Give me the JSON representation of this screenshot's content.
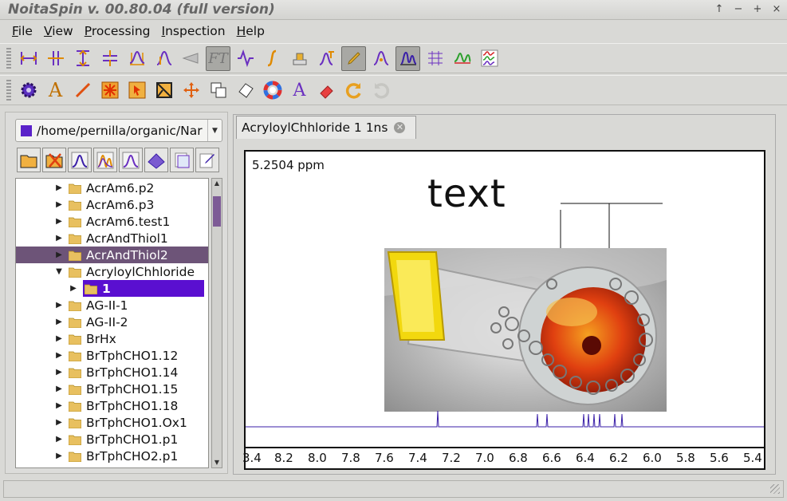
{
  "window": {
    "title": "NoitaSpin v. 00.80.04 (full version)",
    "buttons": [
      "↑",
      "−",
      "+",
      "×"
    ]
  },
  "menu": [
    {
      "mnemonic": "F",
      "rest": "ile"
    },
    {
      "mnemonic": "V",
      "rest": "iew"
    },
    {
      "mnemonic": "P",
      "rest": "rocessing"
    },
    {
      "mnemonic": "I",
      "rest": "nspection"
    },
    {
      "mnemonic": "H",
      "rest": "elp"
    }
  ],
  "toolbar1_icons": [
    "horizontal-range-icon",
    "vertical-cursor-icon",
    "vertical-range-icon",
    "baseline-icon",
    "peak-range-icon",
    "peak-pick-icon",
    "zoom-cone-icon",
    "ft-icon",
    "phase-wave-icon",
    "integral-icon",
    "print-stamp-icon",
    "peak-text-icon",
    "pencil-icon",
    "peak-label-icon",
    "spectrum-view-icon",
    "grid-icon",
    "peak-compare-icon",
    "multi-spectrum-icon"
  ],
  "toolbar1_active": [
    7,
    12,
    14
  ],
  "toolbar1_ft_label": "FT",
  "toolbar2_icons": [
    "settings-gear-icon",
    "text-A-icon",
    "line-icon",
    "burst-icon",
    "cursor-box-icon",
    "cross-box-icon",
    "move-arrows-icon",
    "copy-shape-icon",
    "rotate-shape-icon",
    "color-wheel-icon",
    "font-A-icon",
    "eraser-icon",
    "undo-icon",
    "redo-icon"
  ],
  "path": {
    "text": "/home/pernilla/organic/Nar",
    "color": "#5a22c9"
  },
  "file_tools": [
    "open-folder-icon",
    "delete-folder-icon",
    "spectrum-1d-icon",
    "spectrum-multi-icon",
    "spectrum-single-icon",
    "spectrum-3d-icon",
    "folder-pages-icon",
    "edit-note-icon"
  ],
  "tree": [
    {
      "label": "AcrAm6.p2",
      "state": "collapsed"
    },
    {
      "label": "AcrAm6.p3",
      "state": "collapsed"
    },
    {
      "label": "AcrAm6.test1",
      "state": "collapsed"
    },
    {
      "label": "AcrAndThiol1",
      "state": "collapsed"
    },
    {
      "label": "AcrAndThiol2",
      "state": "collapsed",
      "selected": true
    },
    {
      "label": "AcryloylChhloride",
      "state": "expanded"
    },
    {
      "label": "1",
      "state": "collapsed",
      "child": true
    },
    {
      "label": "AG-II-1",
      "state": "collapsed"
    },
    {
      "label": "AG-II-2",
      "state": "collapsed"
    },
    {
      "label": "BrHx",
      "state": "collapsed"
    },
    {
      "label": "BrTphCHO1.12",
      "state": "collapsed"
    },
    {
      "label": "BrTphCHO1.14",
      "state": "collapsed"
    },
    {
      "label": "BrTphCHO1.15",
      "state": "collapsed"
    },
    {
      "label": "BrTphCHO1.18",
      "state": "collapsed"
    },
    {
      "label": "BrTphCHO1.Ox1",
      "state": "collapsed"
    },
    {
      "label": "BrTphCHO1.p1",
      "state": "collapsed"
    },
    {
      "label": "BrTphCHO2.p1",
      "state": "collapsed"
    }
  ],
  "tab": {
    "label": "AcryloylChhloride 1 1ns",
    "close": "✕"
  },
  "plot": {
    "readout": "5.2504 ppm",
    "annotation": "text",
    "axis_ticks": [
      "3.4",
      "8.2",
      "8.0",
      "7.8",
      "7.6",
      "7.4",
      "7.2",
      "7.0",
      "6.8",
      "6.6",
      "6.4",
      "6.2",
      "6.0",
      "5.8",
      "5.6",
      "5.4"
    ],
    "spectrum_color": "#3a1fa8"
  },
  "status": {
    "text": ""
  }
}
